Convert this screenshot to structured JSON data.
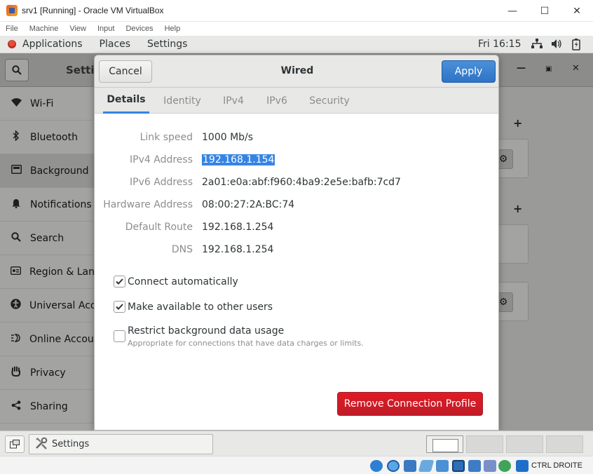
{
  "vbox": {
    "title": "srv1 [Running] - Oracle VM VirtualBox",
    "menus": [
      "File",
      "Machine",
      "View",
      "Input",
      "Devices",
      "Help"
    ],
    "host_key": "CTRL DROITE"
  },
  "topbar": {
    "applications": "Applications",
    "places": "Places",
    "settings": "Settings",
    "clock": "Fri 16:15"
  },
  "settings": {
    "header_title": "Settings",
    "sidebar": [
      {
        "label": "Wi-Fi",
        "icon": "wifi-icon"
      },
      {
        "label": "Bluetooth",
        "icon": "bluetooth-icon"
      },
      {
        "label": "Background",
        "icon": "background-icon"
      },
      {
        "label": "Notifications",
        "icon": "bell-icon"
      },
      {
        "label": "Search",
        "icon": "search-icon"
      },
      {
        "label": "Region & Language",
        "icon": "flag-icon"
      },
      {
        "label": "Universal Access",
        "icon": "accessibility-icon"
      },
      {
        "label": "Online Accounts",
        "icon": "cloud-icon"
      },
      {
        "label": "Privacy",
        "icon": "hand-icon"
      },
      {
        "label": "Sharing",
        "icon": "share-icon"
      }
    ]
  },
  "dialog": {
    "title": "Wired",
    "cancel": "Cancel",
    "apply": "Apply",
    "tabs": [
      "Details",
      "Identity",
      "IPv4",
      "IPv6",
      "Security"
    ],
    "active_tab": "Details",
    "details": [
      {
        "label": "Link speed",
        "value": "1000 Mb/s"
      },
      {
        "label": "IPv4 Address",
        "value": "192.168.1.154"
      },
      {
        "label": "IPv6 Address",
        "value": "2a01:e0a:abf:f960:4ba9:2e5e:bafb:7cd7"
      },
      {
        "label": "Hardware Address",
        "value": "08:00:27:2A:BC:74"
      },
      {
        "label": "Default Route",
        "value": "192.168.1.254"
      },
      {
        "label": "DNS",
        "value": "192.168.1.254"
      }
    ],
    "options": [
      {
        "label": "Connect automatically",
        "checked": true
      },
      {
        "label": "Make available to other users",
        "checked": true
      },
      {
        "label": "Restrict background data usage",
        "checked": false,
        "subtitle": "Appropriate for connections that have data charges or limits."
      }
    ],
    "remove": "Remove Connection Profile"
  },
  "taskbar": {
    "task_label": "Settings"
  },
  "colors": {
    "accent": "#3584e4",
    "apply": "#2f73c6",
    "destructive": "#e01b24"
  }
}
